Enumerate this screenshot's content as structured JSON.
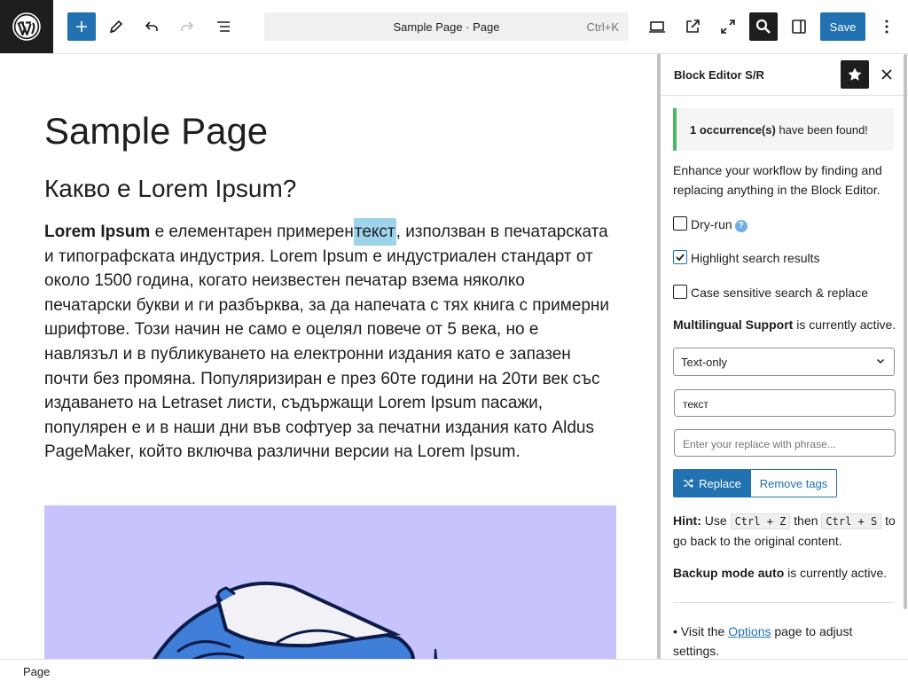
{
  "toolbar": {
    "command_title": "Sample Page · Page",
    "command_shortcut": "Ctrl+K",
    "save_label": "Save"
  },
  "editor": {
    "page_title": "Sample Page",
    "heading": "Какво е Lorem Ipsum?",
    "para_bold": "Lorem Ipsum",
    "para_before": " е елементарен примерен",
    "para_highlight": "текст",
    "para_after": ", използван в печатарската и типографската индустрия. Lorem Ipsum е индустриален стандарт от около 1500 година, когато неизвестен печатар взема няколко печатарски букви и ги разбърква, за да напечата с тях книга с примерни шрифтове. Този начин не само е оцелял повече от 5 века, но е навлязъл и в публикуването на електронни издания като е запазен почти без промяна. Популяризиран е през 60те години на 20ти век със издаването на Letraset листи, съдържащи Lorem Ipsum пасажи, популярен е и в наши дни във софтуер за печатни издания като Aldus PageMaker, който включва различни версии на Lorem Ipsum.",
    "image_bg": "#c6c3fd"
  },
  "sidebar": {
    "title": "Block Editor S/R",
    "notice_bold": "1 occurrence(s)",
    "notice_rest": " have been found!",
    "description": "Enhance your workflow by finding and replacing anything in the Block Editor.",
    "options": [
      {
        "label": "Dry-run",
        "checked": false,
        "help": "?"
      },
      {
        "label": "Highlight search results",
        "checked": true
      },
      {
        "label": "Case sensitive search & replace",
        "checked": false
      }
    ],
    "multilingual_bold": "Multilingual Support",
    "multilingual_rest": " is currently active.",
    "select_value": "Text-only",
    "search_value": "текст",
    "replace_placeholder": "Enter your replace with phrase...",
    "replace_button": "Replace",
    "remove_tags_button": "Remove tags",
    "hint_bold": "Hint:",
    "hint_use": " Use ",
    "hint_key1": "Ctrl + Z",
    "hint_then": " then ",
    "hint_key2": "Ctrl + S",
    "hint_rest": " to go back to the original content.",
    "backup_bold": "Backup mode auto",
    "backup_rest": " is currently active.",
    "visit_before": "• Visit the ",
    "visit_link": "Options",
    "visit_after": " page to adjust settings."
  },
  "footer": {
    "breadcrumb": "Page"
  },
  "colors": {
    "accent": "#2271b1",
    "success": "#4ab866",
    "highlight": "#9ed3ec",
    "dark": "#1e1e1e"
  }
}
